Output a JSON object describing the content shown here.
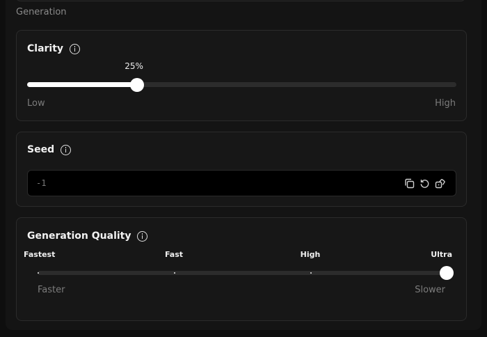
{
  "section": {
    "title": "Generation"
  },
  "clarity": {
    "title": "Clarity",
    "value_label": "25%",
    "value_fraction": 0.25,
    "low_label": "Low",
    "high_label": "High"
  },
  "seed": {
    "title": "Seed",
    "value": "-1",
    "icons": [
      "copy-icon",
      "reset-icon",
      "dice-icon"
    ]
  },
  "quality": {
    "title": "Generation Quality",
    "levels": [
      "Fastest",
      "Fast",
      "High",
      "Ultra"
    ],
    "selected_index": 3,
    "left_caption": "Faster",
    "right_caption": "Slower"
  },
  "colors": {
    "background": "#141414",
    "card": "#171717",
    "accent": "#ffffff",
    "muted_text": "#7c7c7c"
  }
}
